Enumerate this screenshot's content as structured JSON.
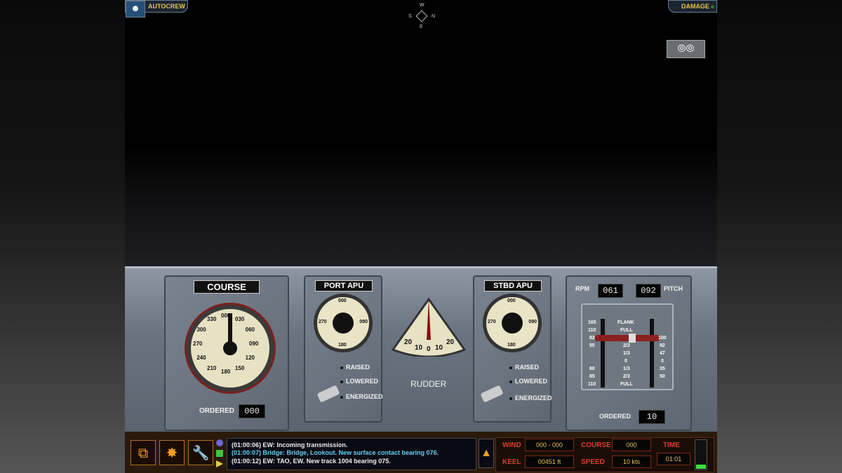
{
  "top": {
    "autocrew_label": "AUTOCREW",
    "damage_label": "DAMAGE",
    "damage_chevron": "«",
    "compass": {
      "n": "N",
      "e": "E",
      "s": "S",
      "w": "W"
    },
    "binoculars_glyph": "⦾⦾"
  },
  "course": {
    "title": "COURSE",
    "ordered_label": "ORDERED",
    "ordered_value": "000",
    "ticks": [
      "000",
      "030",
      "060",
      "090",
      "120",
      "150",
      "180",
      "210",
      "240",
      "270",
      "300",
      "330"
    ]
  },
  "port_apu": {
    "title": "PORT APU",
    "ticks": [
      "000",
      "090",
      "180",
      "270"
    ],
    "options": [
      "RAISED",
      "LOWERED",
      "ENERGIZED"
    ]
  },
  "rudder": {
    "label": "RUDDER",
    "ticks": [
      "20",
      "10",
      "0",
      "10",
      "20"
    ]
  },
  "stbd_apu": {
    "title": "STBD APU",
    "ticks": [
      "000",
      "090",
      "180",
      "270"
    ],
    "options": [
      "RAISED",
      "LOWERED",
      "ENERGIZED"
    ]
  },
  "engine": {
    "rpm_label": "RPM",
    "rpm_value": "061",
    "pitch_label": "PITCH",
    "pitch_value": "092",
    "ordered_label": "ORDERED",
    "ordered_value": "10",
    "left_scale": [
      "165",
      "110",
      "82",
      "55",
      "",
      "",
      "",
      "60",
      "85",
      "110"
    ],
    "center_scale": [
      "FLANK",
      "FULL",
      "",
      "2/3",
      "1/3",
      "0",
      "1/3",
      "2/3",
      "FULL"
    ],
    "right_scale": [
      "",
      "",
      "100",
      "92",
      "47",
      "0",
      "35",
      "50"
    ]
  },
  "messages": [
    {
      "text": "(01:00:06) EW: Incoming transmission.",
      "color": "#f0f0f0"
    },
    {
      "text": "(01:00:07) Bridge: Bridge, Lookout. New surface contact bearing 076.",
      "color": "#60d0f0"
    },
    {
      "text": "(01:00:12) EW: TAO, EW. New track 1004 bearing 075.",
      "color": "#f0f0f0"
    }
  ],
  "nav": {
    "wind_label": "WIND",
    "wind_value": "000 - 000",
    "keel_label": "KEEL",
    "keel_value": "00451 ft",
    "course_label": "COURSE",
    "course_value": "000",
    "speed_label": "SPEED",
    "speed_value": "10  kts",
    "time_label": "TIME",
    "time_value": "01:01"
  },
  "icons": {
    "windows": "⧉",
    "explosion": "✸",
    "wrench": "🔧",
    "heading_arrow": "▲"
  }
}
